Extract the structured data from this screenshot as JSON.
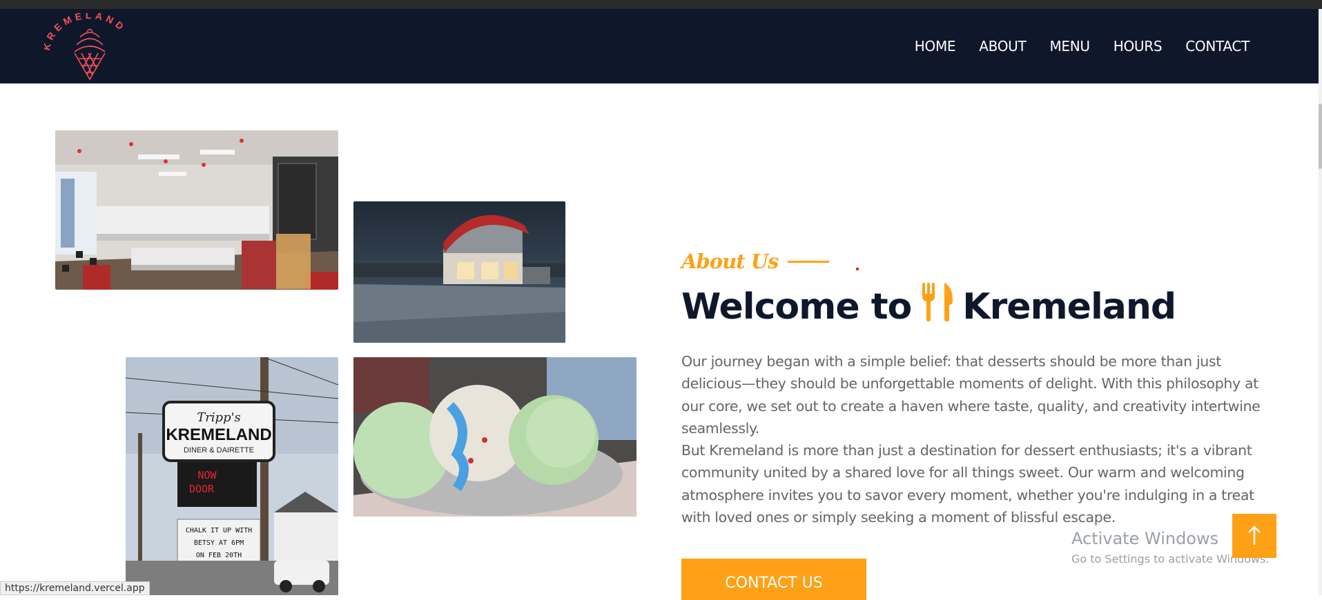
{
  "brand": {
    "logo_text": "KREMELAND",
    "accent": "#fea116",
    "navy": "#0f172b"
  },
  "nav": {
    "items": [
      "HOME",
      "ABOUT",
      "MENU",
      "HOURS",
      "CONTACT"
    ]
  },
  "about": {
    "eyebrow": "About Us",
    "heading_prefix": "Welcome to",
    "heading_brand": "Kremeland",
    "heading_icon": "utensils-icon",
    "paragraph1": "Our journey began with a simple belief: that desserts should be more than just delicious—they should be unforgettable moments of delight. With this philosophy at our core, we set out to create a haven where taste, quality, and creativity intertwine seamlessly.",
    "paragraph2": "But Kremeland is more than just a destination for dessert enthusiasts; it's a vibrant community united by a shared love for all things sweet. Our warm and welcoming atmosphere invites you to savor every moment, whether you're indulging in a treat with loved ones or simply seeking a moment of blissful escape.",
    "cta": "CONTACT US"
  },
  "sign": {
    "line1": "Tripp's",
    "line2": "KREMELAND",
    "line3": "DINER & DAIRETTE",
    "led1": "NOW",
    "led2": "DOOR",
    "board1": "CHALK IT UP WITH",
    "board2": "BETSY AT 6PM",
    "board3": "ON FEB 20TH"
  },
  "overlay": {
    "activate_title": "Activate Windows",
    "activate_sub": "Go to Settings to activate Windows."
  },
  "status_url": "https://kremeland.vercel.app"
}
